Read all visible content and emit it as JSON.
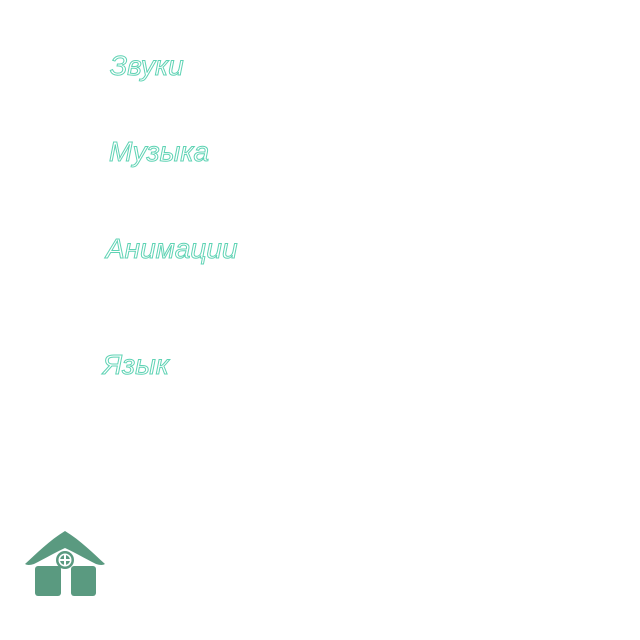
{
  "settings_menu": {
    "items": [
      {
        "label": "Звуки"
      },
      {
        "label": "Музыка"
      },
      {
        "label": "Анимации"
      },
      {
        "label": "Язык"
      }
    ]
  },
  "home_button": {
    "icon": "home-icon"
  },
  "colors": {
    "label_outline": "#5fd3b4",
    "label_fill": "#ffffff",
    "home_icon": "#5a9a80",
    "background": "#ffffff"
  }
}
